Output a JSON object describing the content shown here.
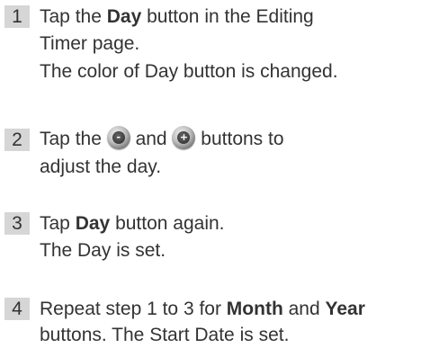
{
  "steps": [
    {
      "number": "1",
      "line1_pre": "Tap the ",
      "line1_bold": "Day",
      "line1_post": " button in the Editing",
      "line2": "Timer page.",
      "line3": "The color of Day button is changed."
    },
    {
      "number": "2",
      "line1_pre": "Tap the ",
      "line1_mid": " and ",
      "line1_post": " buttons to",
      "line2": "adjust the day.",
      "icon_minus": "minus-round-icon",
      "icon_minus_glyph": "-",
      "icon_plus": "plus-round-icon",
      "icon_plus_glyph": "+"
    },
    {
      "number": "3",
      "line1_pre": "Tap ",
      "line1_bold": "Day",
      "line1_post": " button again.",
      "line2": "The Day is set."
    },
    {
      "number": "4",
      "line1_pre": "Repeat step 1 to 3 for ",
      "line1_bold1": "Month",
      "line1_mid": " and ",
      "line1_bold2": "Year",
      "line2": "buttons. The Start Date is set."
    }
  ]
}
